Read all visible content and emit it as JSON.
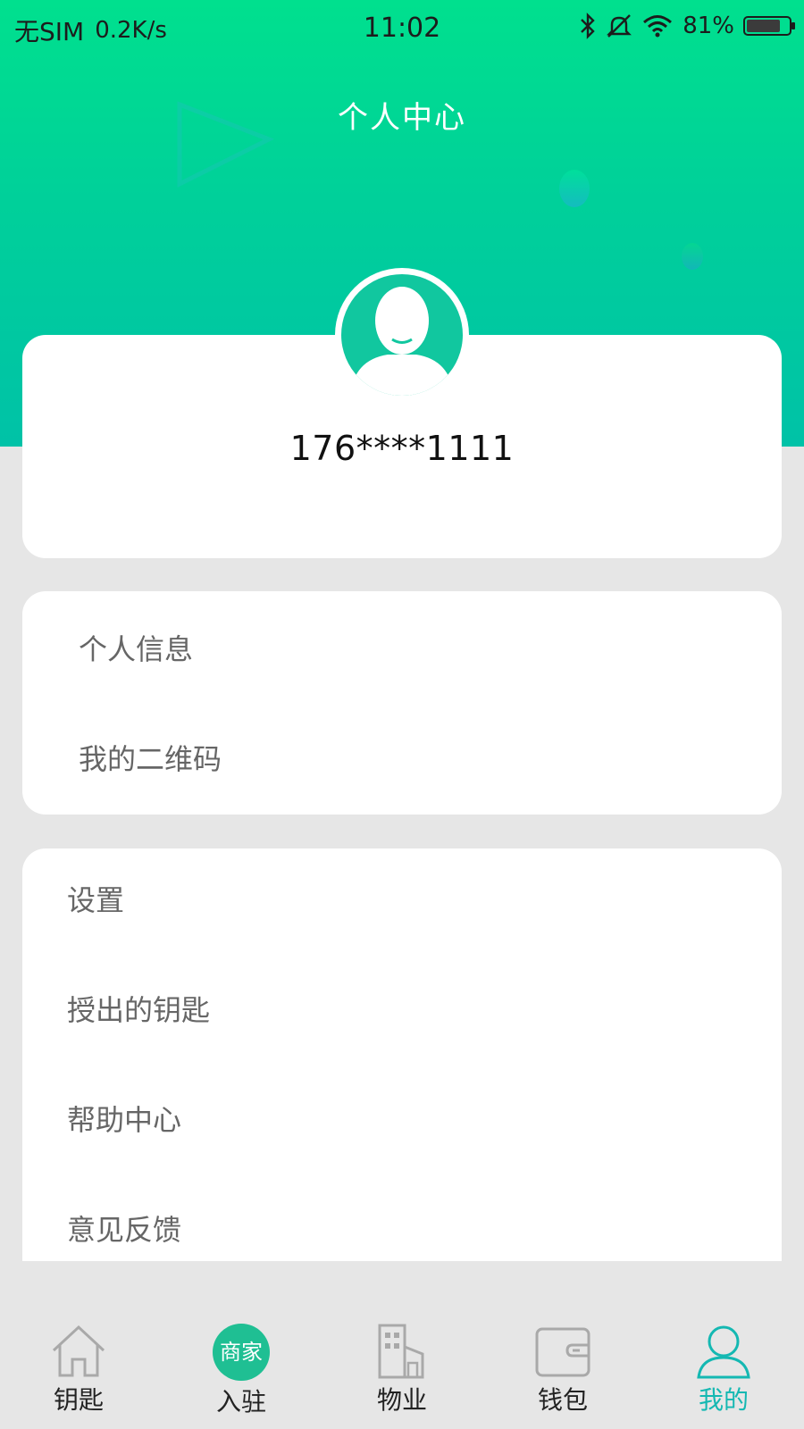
{
  "status_bar": {
    "carrier": "无SIM",
    "speed": "0.2K/s",
    "time": "11:02",
    "battery": "81%",
    "battery_level": 0.81,
    "icons": [
      "bluetooth-icon",
      "bell-muted-icon",
      "wifi-icon",
      "battery-icon"
    ]
  },
  "header": {
    "title": "个人中心"
  },
  "profile": {
    "phone": "176****1111"
  },
  "menu_group_1": [
    {
      "label": "个人信息"
    },
    {
      "label": "我的二维码"
    }
  ],
  "menu_group_2": [
    {
      "label": "设置"
    },
    {
      "label": "授出的钥匙"
    },
    {
      "label": "帮助中心"
    },
    {
      "label": "意见反馈"
    }
  ],
  "tabs": [
    {
      "label": "钥匙",
      "icon": "home-icon"
    },
    {
      "label": "入驻",
      "icon": "merchant-badge-icon",
      "badge_text": "商家"
    },
    {
      "label": "物业",
      "icon": "building-icon"
    },
    {
      "label": "钱包",
      "icon": "wallet-icon"
    },
    {
      "label": "我的",
      "icon": "person-icon",
      "active": true
    }
  ],
  "colors": {
    "header_top": "#00e08e",
    "header_bottom": "#00c2a7",
    "accent": "#14b8b2",
    "avatar": "#11c79f",
    "background": "#e6e6e6"
  }
}
